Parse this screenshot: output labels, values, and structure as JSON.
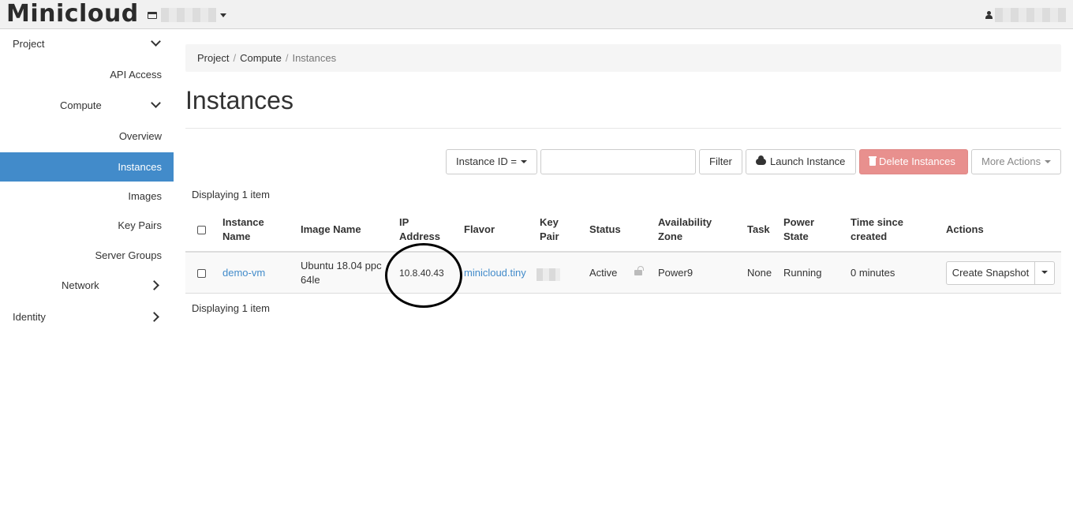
{
  "app": {
    "brand": "Minicloud"
  },
  "sidebar": {
    "items": [
      {
        "label": "Project"
      },
      {
        "label": "API Access"
      },
      {
        "label": "Compute"
      },
      {
        "label": "Overview"
      },
      {
        "label": "Instances"
      },
      {
        "label": "Images"
      },
      {
        "label": "Key Pairs"
      },
      {
        "label": "Server Groups"
      },
      {
        "label": "Network"
      },
      {
        "label": "Identity"
      }
    ]
  },
  "breadcrumb": {
    "items": [
      "Project",
      "Compute",
      "Instances"
    ],
    "separator": "/"
  },
  "page": {
    "title": "Instances"
  },
  "toolbar": {
    "filter_field": "Instance ID =",
    "search_value": "",
    "filter_label": "Filter",
    "launch_label": "Launch Instance",
    "delete_label": "Delete Instances",
    "more_label": "More Actions"
  },
  "table": {
    "count_text": "Displaying 1 item",
    "headers": {
      "name": [
        "Instance",
        "Name"
      ],
      "image": "Image Name",
      "ip": [
        "IP",
        "Address"
      ],
      "flavor": "Flavor",
      "keypair": [
        "Key",
        "Pair"
      ],
      "status": "Status",
      "az": [
        "Availability",
        "Zone"
      ],
      "task": "Task",
      "power": [
        "Power",
        "State"
      ],
      "time": [
        "Time since",
        "created"
      ],
      "actions": "Actions"
    },
    "rows": [
      {
        "name": "demo-vm",
        "image": [
          "Ubuntu 18.04 ppc",
          "64le"
        ],
        "ip": "10.8.40.43",
        "flavor": "minicloud.tiny",
        "status": "Active",
        "az": "Power9",
        "task": "None",
        "power": "Running",
        "time": "0 minutes",
        "action_label": "Create Snapshot"
      }
    ]
  },
  "colors": {
    "accent": "#428bca",
    "danger": "#e8908e",
    "annotation": "#000000"
  },
  "icons": [
    "project-icon",
    "user-icon",
    "chevron-down-icon",
    "chevron-right-icon",
    "cloud-upload-icon",
    "trash-icon",
    "lock-icon",
    "caret-down-icon"
  ]
}
